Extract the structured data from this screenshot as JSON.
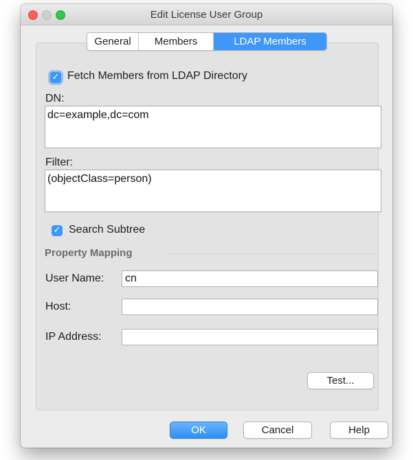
{
  "window": {
    "title": "Edit License User Group",
    "traffic_lights": [
      "close",
      "minimize",
      "maximize"
    ]
  },
  "tabs": [
    {
      "label": "General",
      "selected": false
    },
    {
      "label": "Members",
      "selected": false
    },
    {
      "label": "LDAP Members",
      "selected": true
    }
  ],
  "ldap": {
    "fetch_label": "Fetch Members from LDAP Directory",
    "fetch_checked": true,
    "dn_label": "DN:",
    "dn_value": "dc=example,dc=com",
    "filter_label": "Filter:",
    "filter_value": "(objectClass=person)",
    "subtree_label": "Search Subtree",
    "subtree_checked": true
  },
  "mapping": {
    "heading": "Property Mapping",
    "user_name_label": "User Name:",
    "user_name_value": "cn",
    "host_label": "Host:",
    "host_value": "",
    "ip_label": "IP Address:",
    "ip_value": ""
  },
  "buttons": {
    "test": "Test...",
    "ok": "OK",
    "cancel": "Cancel",
    "help": "Help"
  },
  "colors": {
    "accent": "#3e97f9",
    "close": "#fc605c",
    "maximize": "#34c84a"
  }
}
